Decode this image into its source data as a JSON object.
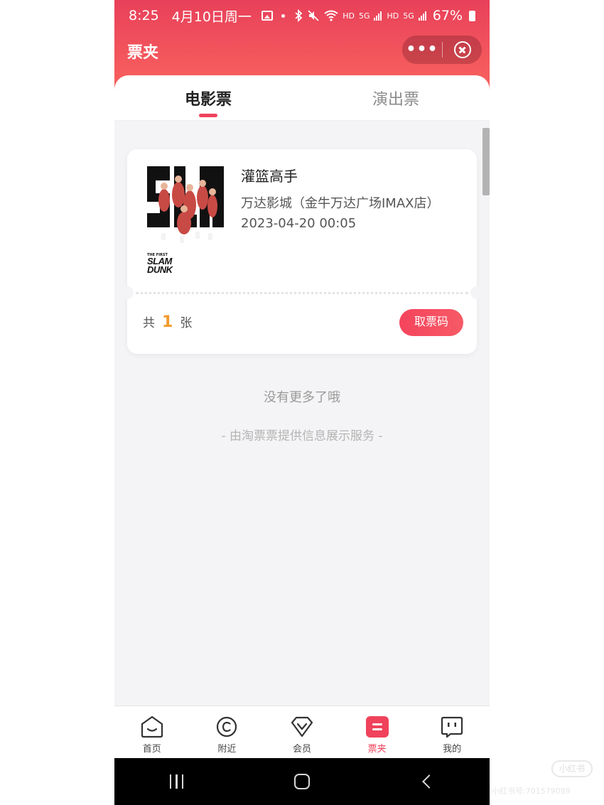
{
  "status_bar": {
    "time": "8:25",
    "date": "4月10日周一",
    "hd1": "HD",
    "sig1": "5G",
    "hd2": "HD",
    "sig2": "5G",
    "battery": "67%"
  },
  "header": {
    "title": "票夹",
    "more_label": "•••"
  },
  "tabs": [
    {
      "label": "电影票",
      "active": true
    },
    {
      "label": "演出票",
      "active": false
    }
  ],
  "ticket": {
    "movie_name": "灌篮高手",
    "cinema": "万达影城（金牛万达广场IMAX店）",
    "showtime": "2023-04-20 00:05",
    "count_prefix": "共",
    "count": "1",
    "count_suffix": "张",
    "get_code_label": "取票码",
    "poster": {
      "top_text": "THE FIRST",
      "logo_line1": "SLAM",
      "logo_line2": "DUNK"
    }
  },
  "list_end_text": "没有更多了哦",
  "provider_text": "- 由淘票票提供信息展示服务 -",
  "bottom_nav": [
    {
      "label": "首页",
      "icon": "home-face-icon",
      "active": false
    },
    {
      "label": "附近",
      "icon": "nearby-c-icon",
      "active": false
    },
    {
      "label": "会员",
      "icon": "member-diamond-icon",
      "active": false
    },
    {
      "label": "票夹",
      "icon": "ticket-wallet-icon",
      "active": true
    },
    {
      "label": "我的",
      "icon": "profile-face-icon",
      "active": false
    }
  ],
  "watermark": {
    "logo": "小红书",
    "id": "小红书号:701579089"
  },
  "colors": {
    "accent": "#f0425b",
    "count_highlight": "#f39a2b"
  }
}
